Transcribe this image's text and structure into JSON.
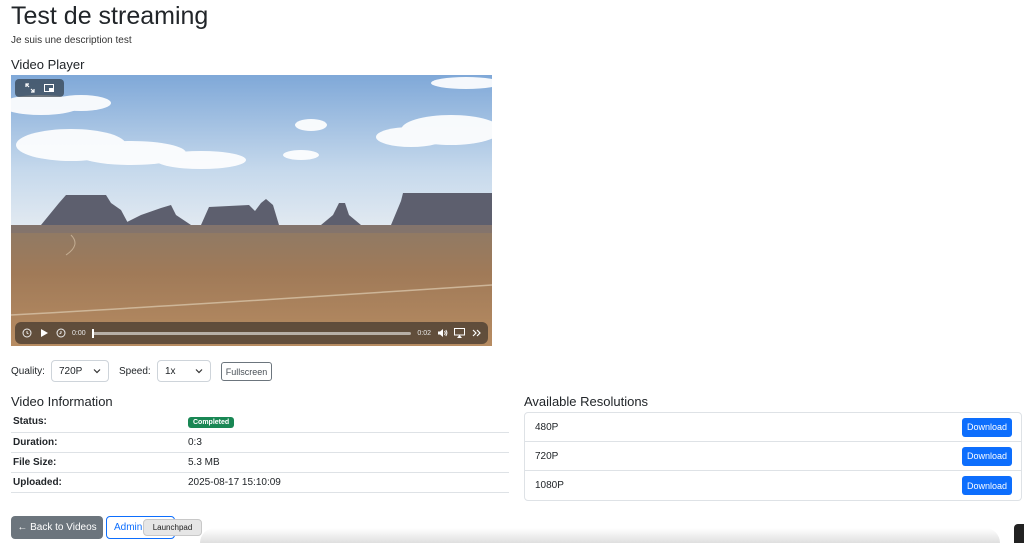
{
  "page": {
    "title": "Test de streaming",
    "description": "Je suis une description test"
  },
  "player": {
    "heading": "Video Player",
    "current_time": "0:00",
    "total_time": "0:02",
    "progress": 0.0,
    "icons": [
      "expand-icon",
      "pip-icon",
      "rewind-icon",
      "play-icon",
      "forward-icon",
      "volume-icon",
      "airplay-icon",
      "more-icon"
    ]
  },
  "controls": {
    "quality_label": "Quality:",
    "quality_value": "720P",
    "speed_label": "Speed:",
    "speed_value": "1x",
    "fullscreen_label": "Fullscreen"
  },
  "info": {
    "heading": "Video Information",
    "rows": [
      {
        "key": "Status:",
        "value": "Completed"
      },
      {
        "key": "Duration:",
        "value": "0:3"
      },
      {
        "key": "File Size:",
        "value": "5.3 MB"
      },
      {
        "key": "Uploaded:",
        "value": "2025-08-17 15:10:09"
      }
    ],
    "status_color": "#198754"
  },
  "resolutions": {
    "heading": "Available Resolutions",
    "items": [
      {
        "label": "480P",
        "action": "Download"
      },
      {
        "label": "720P",
        "action": "Download"
      },
      {
        "label": "1080P",
        "action": "Download"
      }
    ]
  },
  "footer": {
    "back_label": "← Back to Videos",
    "admin_label": "Admin",
    "tooltip": "Launchpad"
  },
  "colors": {
    "primary": "#0d6efd",
    "secondary": "#6c757d",
    "success": "#198754"
  }
}
